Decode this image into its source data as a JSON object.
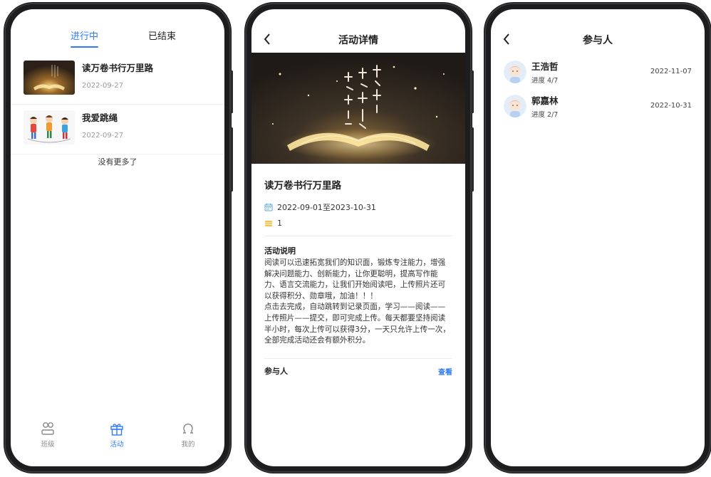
{
  "list_screen": {
    "tabs": [
      {
        "label": "进行中",
        "active": true
      },
      {
        "label": "已结束",
        "active": false
      }
    ],
    "activities": [
      {
        "title": "读万卷书行万里路",
        "date": "2022-09-27",
        "thumb_icon": "reading-book-image"
      },
      {
        "title": "我爱跳绳",
        "date": "2022-09-27",
        "thumb_icon": "jump-rope-kids-image"
      }
    ],
    "no_more_text": "没有更多了",
    "bottom_nav": [
      {
        "label": "班级",
        "icon": "class-icon",
        "active": false
      },
      {
        "label": "活动",
        "icon": "gift-icon",
        "active": true
      },
      {
        "label": "我的",
        "icon": "profile-icon",
        "active": false
      }
    ]
  },
  "detail_screen": {
    "title": "活动详情",
    "banner_icon": "reading-book-banner",
    "activity_title": "读万卷书行万里路",
    "date_range": "2022-09-01至2023-10-31",
    "count": "1",
    "description_title": "活动说明",
    "description_p1": "阅读可以迅速拓宽我们的知识面，锻炼专注能力，增强解决问题能力、创新能力，让你更聪明，提高写作能力、语言交流能力，让我们开始阅读吧，上传照片还可以获得积分、勋章哦，加油！！！",
    "description_p2": "点击去完成，自动跳转到记录页面，学习——阅读——上传照片——提交，即可完成上传。每天都要坚持阅读半小时，每次上传可以获得3分，一天只允许上传一次，全部完成活动还会有额外积分。",
    "participants_label": "参与人",
    "view_label": "查看"
  },
  "participants_screen": {
    "title": "参与人",
    "users": [
      {
        "name": "王浩哲",
        "progress": "进度 4/7",
        "date": "2022-11-07"
      },
      {
        "name": "郭嘉林",
        "progress": "进度 2/7",
        "date": "2022-10-31"
      }
    ]
  },
  "colors": {
    "accent": "#2f7bf4",
    "phone_frame": "#1d1d1f",
    "muted_text": "#9a9a9a",
    "calendar_icon": "#5aa7e8",
    "count_icon": "#f2c14e"
  }
}
